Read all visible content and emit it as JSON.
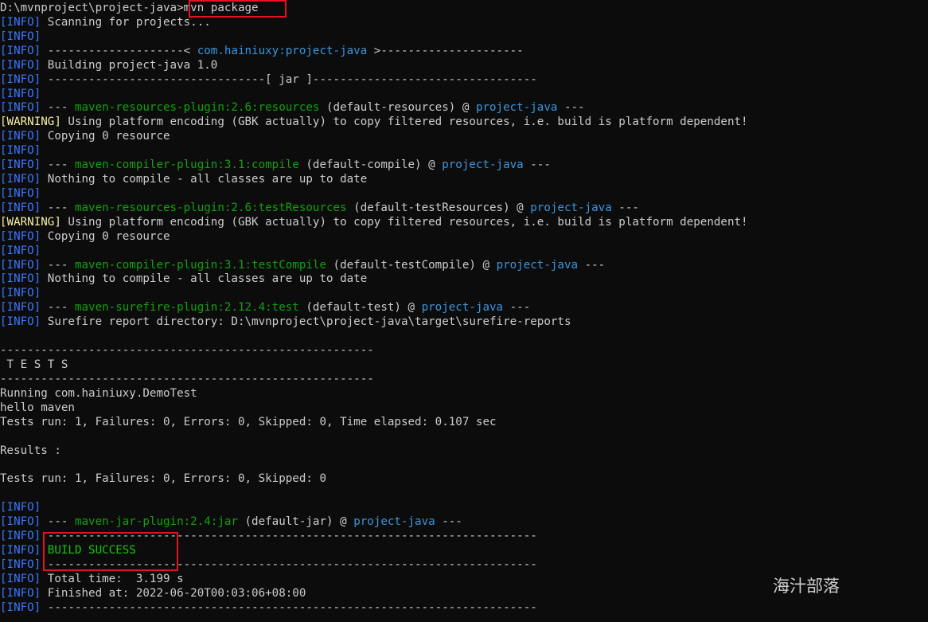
{
  "colors": {
    "background": "#0c0c0c",
    "default_text": "#cccccc",
    "info_tag": "#3b78ff",
    "warning_tag": "#f9f1a5",
    "plugin": "#13a10e",
    "artifact": "#3a96dd",
    "success": "#16c60c",
    "highlight_box": "#e81123"
  },
  "lines": [
    {
      "segments": [
        {
          "text": "D:\\mvnproject\\project-java>",
          "color": "default"
        },
        {
          "text": "mvn package",
          "color": "default"
        }
      ]
    },
    {
      "segments": [
        {
          "text": "[INFO]",
          "color": "info"
        },
        {
          "text": " Scanning for projects...",
          "color": "default"
        }
      ]
    },
    {
      "segments": [
        {
          "text": "[INFO]",
          "color": "info"
        }
      ]
    },
    {
      "segments": [
        {
          "text": "[INFO]",
          "color": "info"
        },
        {
          "text": " --------------------< ",
          "color": "default"
        },
        {
          "text": "com.hainiuxy:project-java",
          "color": "artifact"
        },
        {
          "text": " >---------------------",
          "color": "default"
        }
      ]
    },
    {
      "segments": [
        {
          "text": "[INFO]",
          "color": "info"
        },
        {
          "text": " Building project-java 1.0",
          "color": "default"
        }
      ]
    },
    {
      "segments": [
        {
          "text": "[INFO]",
          "color": "info"
        },
        {
          "text": " --------------------------------[ jar ]---------------------------------",
          "color": "default"
        }
      ]
    },
    {
      "segments": [
        {
          "text": "[INFO]",
          "color": "info"
        }
      ]
    },
    {
      "segments": [
        {
          "text": "[INFO]",
          "color": "info"
        },
        {
          "text": " --- ",
          "color": "default"
        },
        {
          "text": "maven-resources-plugin:2.6:resources",
          "color": "plugin"
        },
        {
          "text": " (default-resources) @ ",
          "color": "default"
        },
        {
          "text": "project-java",
          "color": "artifact"
        },
        {
          "text": " ---",
          "color": "default"
        }
      ]
    },
    {
      "segments": [
        {
          "text": "[WARNING]",
          "color": "warning"
        },
        {
          "text": " Using platform encoding (GBK actually) to copy filtered resources, i.e. build is platform dependent!",
          "color": "default"
        }
      ]
    },
    {
      "segments": [
        {
          "text": "[INFO]",
          "color": "info"
        },
        {
          "text": " Copying 0 resource",
          "color": "default"
        }
      ]
    },
    {
      "segments": [
        {
          "text": "[INFO]",
          "color": "info"
        }
      ]
    },
    {
      "segments": [
        {
          "text": "[INFO]",
          "color": "info"
        },
        {
          "text": " --- ",
          "color": "default"
        },
        {
          "text": "maven-compiler-plugin:3.1:compile",
          "color": "plugin"
        },
        {
          "text": " (default-compile) @ ",
          "color": "default"
        },
        {
          "text": "project-java",
          "color": "artifact"
        },
        {
          "text": " ---",
          "color": "default"
        }
      ]
    },
    {
      "segments": [
        {
          "text": "[INFO]",
          "color": "info"
        },
        {
          "text": " Nothing to compile - all classes are up to date",
          "color": "default"
        }
      ]
    },
    {
      "segments": [
        {
          "text": "[INFO]",
          "color": "info"
        }
      ]
    },
    {
      "segments": [
        {
          "text": "[INFO]",
          "color": "info"
        },
        {
          "text": " --- ",
          "color": "default"
        },
        {
          "text": "maven-resources-plugin:2.6:testResources",
          "color": "plugin"
        },
        {
          "text": " (default-testResources) @ ",
          "color": "default"
        },
        {
          "text": "project-java",
          "color": "artifact"
        },
        {
          "text": " ---",
          "color": "default"
        }
      ]
    },
    {
      "segments": [
        {
          "text": "[WARNING]",
          "color": "warning"
        },
        {
          "text": " Using platform encoding (GBK actually) to copy filtered resources, i.e. build is platform dependent!",
          "color": "default"
        }
      ]
    },
    {
      "segments": [
        {
          "text": "[INFO]",
          "color": "info"
        },
        {
          "text": " Copying 0 resource",
          "color": "default"
        }
      ]
    },
    {
      "segments": [
        {
          "text": "[INFO]",
          "color": "info"
        }
      ]
    },
    {
      "segments": [
        {
          "text": "[INFO]",
          "color": "info"
        },
        {
          "text": " --- ",
          "color": "default"
        },
        {
          "text": "maven-compiler-plugin:3.1:testCompile",
          "color": "plugin"
        },
        {
          "text": " (default-testCompile) @ ",
          "color": "default"
        },
        {
          "text": "project-java",
          "color": "artifact"
        },
        {
          "text": " ---",
          "color": "default"
        }
      ]
    },
    {
      "segments": [
        {
          "text": "[INFO]",
          "color": "info"
        },
        {
          "text": " Nothing to compile - all classes are up to date",
          "color": "default"
        }
      ]
    },
    {
      "segments": [
        {
          "text": "[INFO]",
          "color": "info"
        }
      ]
    },
    {
      "segments": [
        {
          "text": "[INFO]",
          "color": "info"
        },
        {
          "text": " --- ",
          "color": "default"
        },
        {
          "text": "maven-surefire-plugin:2.12.4:test",
          "color": "plugin"
        },
        {
          "text": " (default-test) @ ",
          "color": "default"
        },
        {
          "text": "project-java",
          "color": "artifact"
        },
        {
          "text": " ---",
          "color": "default"
        }
      ]
    },
    {
      "segments": [
        {
          "text": "[INFO]",
          "color": "info"
        },
        {
          "text": " Surefire report directory: D:\\mvnproject\\project-java\\target\\surefire-reports",
          "color": "default"
        }
      ]
    },
    {
      "segments": []
    },
    {
      "segments": [
        {
          "text": "-------------------------------------------------------",
          "color": "default"
        }
      ]
    },
    {
      "segments": [
        {
          "text": " T E S T S",
          "color": "default"
        }
      ]
    },
    {
      "segments": [
        {
          "text": "-------------------------------------------------------",
          "color": "default"
        }
      ]
    },
    {
      "segments": [
        {
          "text": "Running com.hainiuxy.DemoTest",
          "color": "default"
        }
      ]
    },
    {
      "segments": [
        {
          "text": "hello maven",
          "color": "default"
        }
      ]
    },
    {
      "segments": [
        {
          "text": "Tests run: 1, Failures: 0, Errors: 0, Skipped: 0, Time elapsed: 0.107 sec",
          "color": "default"
        }
      ]
    },
    {
      "segments": []
    },
    {
      "segments": [
        {
          "text": "Results :",
          "color": "default"
        }
      ]
    },
    {
      "segments": []
    },
    {
      "segments": [
        {
          "text": "Tests run: 1, Failures: 0, Errors: 0, Skipped: 0",
          "color": "default"
        }
      ]
    },
    {
      "segments": []
    },
    {
      "segments": [
        {
          "text": "[INFO]",
          "color": "info"
        }
      ]
    },
    {
      "segments": [
        {
          "text": "[INFO]",
          "color": "info"
        },
        {
          "text": " --- ",
          "color": "default"
        },
        {
          "text": "maven-jar-plugin:2.4:jar",
          "color": "plugin"
        },
        {
          "text": " (default-jar) @ ",
          "color": "default"
        },
        {
          "text": "project-java",
          "color": "artifact"
        },
        {
          "text": " ---",
          "color": "default"
        }
      ]
    },
    {
      "segments": [
        {
          "text": "[INFO]",
          "color": "info"
        },
        {
          "text": " ------------------------------------------------------------------------",
          "color": "default"
        }
      ]
    },
    {
      "segments": [
        {
          "text": "[INFO]",
          "color": "info"
        },
        {
          "text": " BUILD SUCCESS",
          "color": "success"
        }
      ]
    },
    {
      "segments": [
        {
          "text": "[INFO]",
          "color": "info"
        },
        {
          "text": " ------------------------------------------------------------------------",
          "color": "default"
        }
      ]
    },
    {
      "segments": [
        {
          "text": "[INFO]",
          "color": "info"
        },
        {
          "text": " Total time:  3.199 s",
          "color": "default"
        }
      ]
    },
    {
      "segments": [
        {
          "text": "[INFO]",
          "color": "info"
        },
        {
          "text": " Finished at: 2022-06-20T00:03:06+08:00",
          "color": "default"
        }
      ]
    },
    {
      "segments": [
        {
          "text": "[INFO]",
          "color": "info"
        },
        {
          "text": " ------------------------------------------------------------------------",
          "color": "default"
        }
      ]
    }
  ],
  "watermark": "海汁部落"
}
